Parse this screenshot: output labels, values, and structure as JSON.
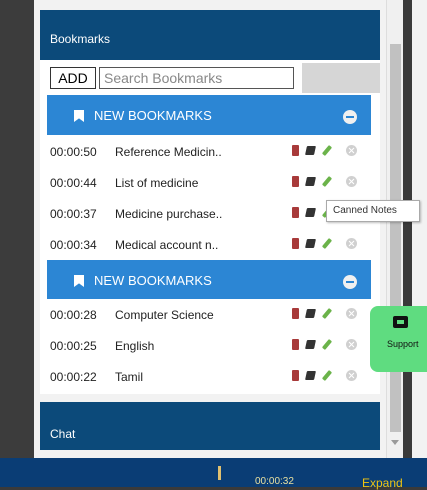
{
  "bookmarks_panel": {
    "title": "Bookmarks",
    "add_label": "ADD",
    "search_placeholder": "Search Bookmarks",
    "groups": [
      {
        "title": "NEW BOOKMARKS",
        "items": [
          {
            "time": "00:00:50",
            "name": "Reference Medicin.."
          },
          {
            "time": "00:00:44",
            "name": "List of medicine"
          },
          {
            "time": "00:00:37",
            "name": "Medicine purchase.."
          },
          {
            "time": "00:00:34",
            "name": "Medical account n.."
          }
        ]
      },
      {
        "title": "NEW BOOKMARKS",
        "items": [
          {
            "time": "00:00:28",
            "name": "Computer Science"
          },
          {
            "time": "00:00:25",
            "name": "English"
          },
          {
            "time": "00:00:22",
            "name": "Tamil"
          }
        ]
      }
    ]
  },
  "tooltip": {
    "text": "Canned Notes"
  },
  "chat_panel": {
    "title": "Chat"
  },
  "support": {
    "label": "Support"
  },
  "bottom_bar": {
    "timer": "00:00:32",
    "expand_label": "Expand"
  },
  "colors": {
    "header": "#0c4a7a",
    "group_header": "#2c86d4",
    "highlight": "#f4f400",
    "support": "#5fdc80"
  },
  "icons": [
    "bookmark-icon",
    "collapse-icon",
    "red-note-icon",
    "canned-notes-icon",
    "edit-icon",
    "delete-icon",
    "chat-icon"
  ]
}
